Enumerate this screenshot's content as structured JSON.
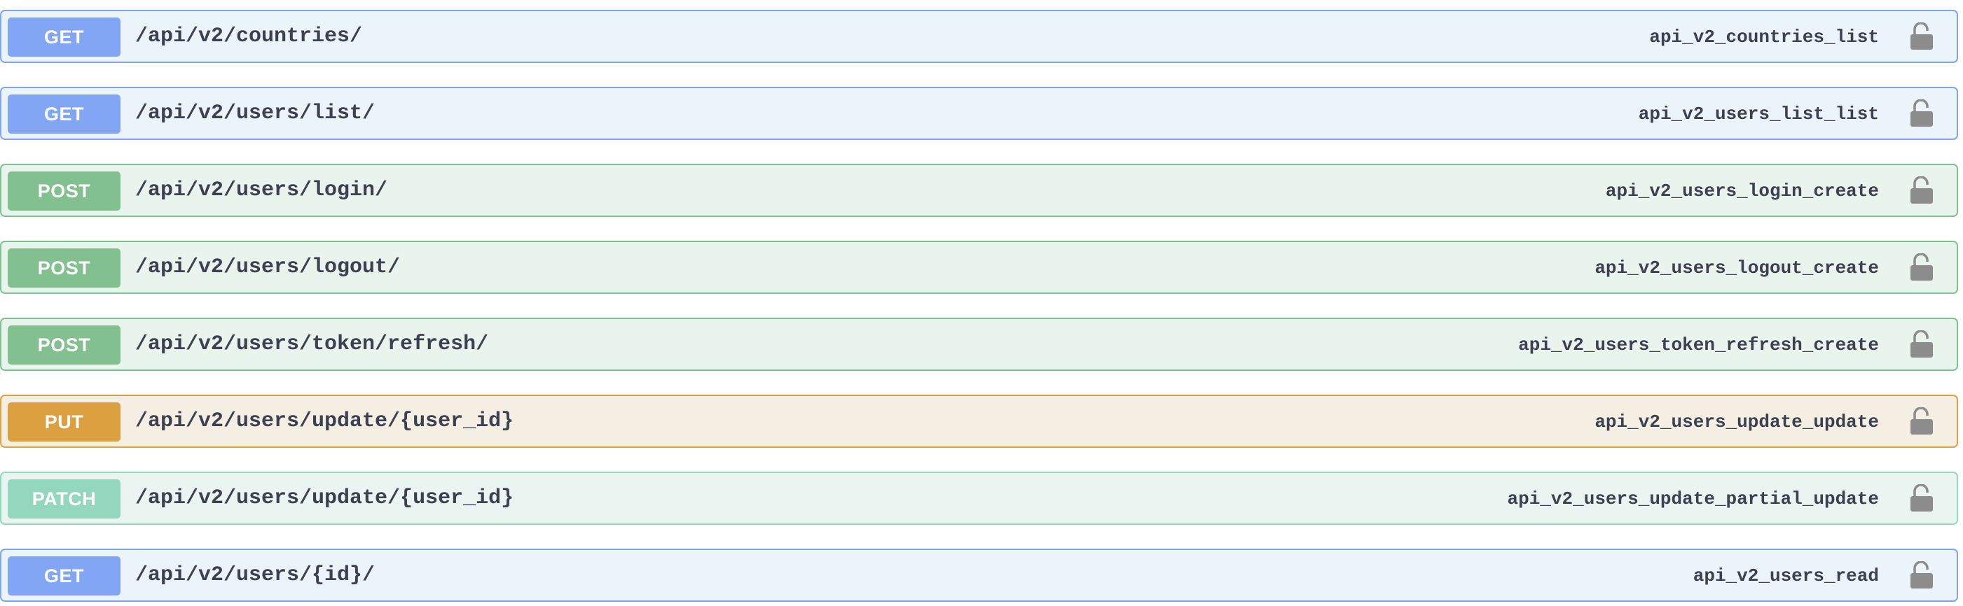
{
  "operations": [
    {
      "method": "GET",
      "path": "/api/v2/countries/",
      "operation_id": "api_v2_countries_list",
      "icon": "unlock-icon"
    },
    {
      "method": "GET",
      "path": "/api/v2/users/list/",
      "operation_id": "api_v2_users_list_list",
      "icon": "unlock-icon"
    },
    {
      "method": "POST",
      "path": "/api/v2/users/login/",
      "operation_id": "api_v2_users_login_create",
      "icon": "unlock-icon"
    },
    {
      "method": "POST",
      "path": "/api/v2/users/logout/",
      "operation_id": "api_v2_users_logout_create",
      "icon": "unlock-icon"
    },
    {
      "method": "POST",
      "path": "/api/v2/users/token/refresh/",
      "operation_id": "api_v2_users_token_refresh_create",
      "icon": "unlock-icon"
    },
    {
      "method": "PUT",
      "path": "/api/v2/users/update/{user_id}",
      "operation_id": "api_v2_users_update_update",
      "icon": "unlock-icon"
    },
    {
      "method": "PATCH",
      "path": "/api/v2/users/update/{user_id}",
      "operation_id": "api_v2_users_update_partial_update",
      "icon": "unlock-icon"
    },
    {
      "method": "GET",
      "path": "/api/v2/users/{id}/",
      "operation_id": "api_v2_users_read",
      "icon": "unlock-icon"
    }
  ],
  "colors": {
    "get_bg": "#ebf3fb",
    "get_badge": "#82a6f4",
    "post_bg": "#e9f4ec",
    "post_badge": "#83c08f",
    "put_bg": "#f5efe3",
    "put_badge": "#dca040",
    "patch_bg": "#eaf5f1",
    "patch_badge": "#93d8be",
    "text": "#3b4151",
    "lock": "#8c8c8c"
  }
}
